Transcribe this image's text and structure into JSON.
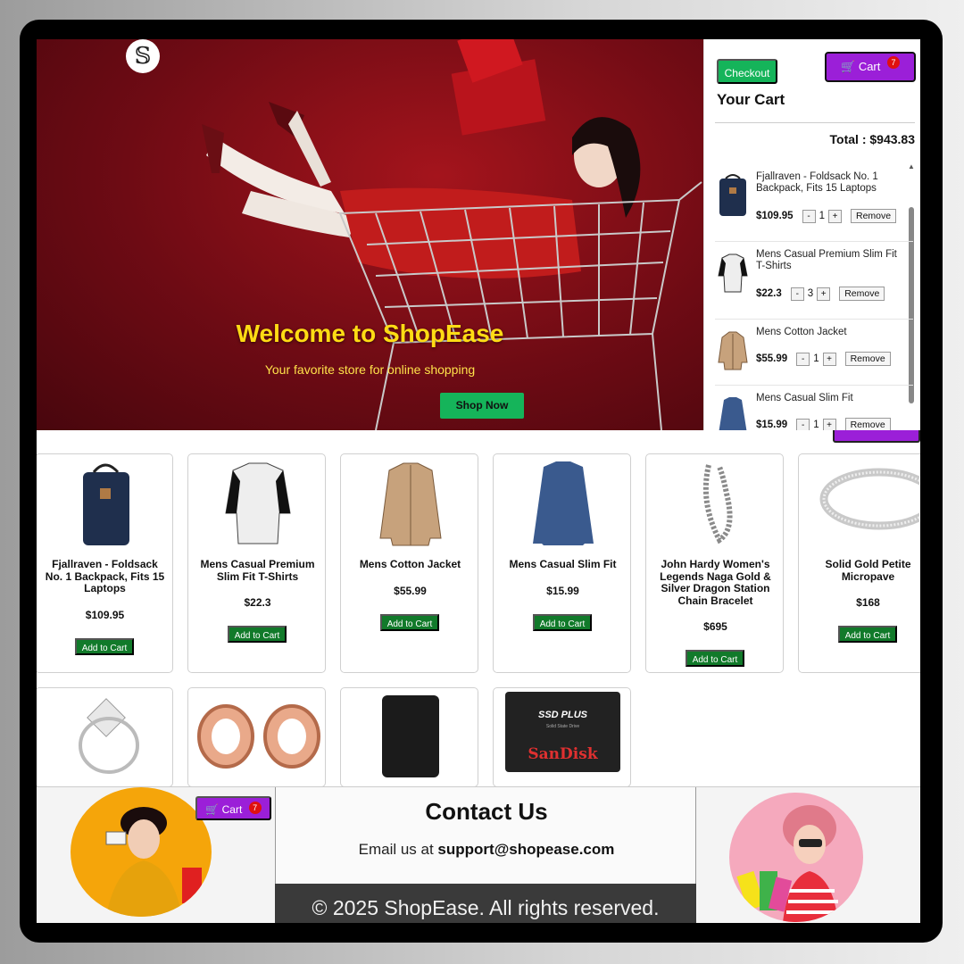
{
  "hero": {
    "logo_glyph": "𝕊",
    "title": "Welcome to ShopEase",
    "subtitle": "Your favorite store for online shopping",
    "cta_label": "Shop Now"
  },
  "cart_panel": {
    "checkout_label": "Checkout",
    "cart_label": "Cart",
    "cart_count": "7",
    "heading": "Your Cart",
    "total": "Total : $943.83",
    "minus": "-",
    "plus": "+",
    "remove_label": "Remove",
    "items": [
      {
        "name": "Fjallraven - Foldsack No. 1 Backpack, Fits 15 Laptops",
        "price": "$109.95",
        "qty": "1"
      },
      {
        "name": "Mens Casual Premium Slim Fit T-Shirts",
        "price": "$22.3",
        "qty": "3"
      },
      {
        "name": "Mens Cotton Jacket",
        "price": "$55.99",
        "qty": "1"
      },
      {
        "name": "Mens Casual Slim Fit",
        "price": "$15.99",
        "qty": "1"
      }
    ]
  },
  "products": {
    "add_label": "Add to Cart",
    "items": [
      {
        "name": "Fjallraven - Foldsack No. 1 Backpack, Fits 15 Laptops",
        "price": "$109.95"
      },
      {
        "name": "Mens Casual Premium Slim Fit T-Shirts",
        "price": "$22.3"
      },
      {
        "name": "Mens Cotton Jacket",
        "price": "$55.99"
      },
      {
        "name": "Mens Casual Slim Fit",
        "price": "$15.99"
      },
      {
        "name": "John Hardy Women's Legends Naga Gold & Silver Dragon Station Chain Bracelet",
        "price": "$695"
      },
      {
        "name": "Solid Gold Petite Micropave",
        "price": "$168"
      }
    ]
  },
  "footer": {
    "cart_label": "Cart",
    "cart_count": "7",
    "contact_title": "Contact Us",
    "email_prefix": "Email us at ",
    "email": "support@shopease.com",
    "copyright": "© 2025 ShopEase. All rights reserved.",
    "ssd_brand": "SanDisk",
    "ssd_model": "SSD PLUS",
    "ssd_caption": "Solid State Drive"
  },
  "colors": {
    "accent_green": "#15b45a",
    "add_green": "#117a2a",
    "cart_purple": "#9b1fd8",
    "hero_red": "#7a0c16",
    "title_yellow": "#ffdc14"
  }
}
